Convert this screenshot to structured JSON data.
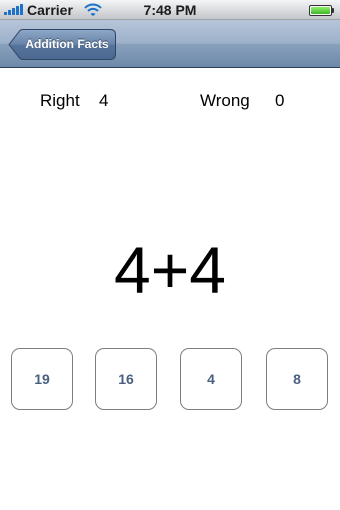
{
  "status_bar": {
    "carrier": "Carrier",
    "time": "7:48 PM",
    "signal_icon": "signal-bars-icon",
    "wifi_icon": "wifi-icon",
    "battery_icon": "battery-icon",
    "battery_level": 1.0,
    "accent_color": "#1a73c8"
  },
  "nav_bar": {
    "back_button_label": "Addition Facts",
    "tint_color": "#6d88aa"
  },
  "score": {
    "right_label": "Right",
    "right_value": "4",
    "wrong_label": "Wrong",
    "wrong_value": "0"
  },
  "problem": {
    "expression": "4+4"
  },
  "answers": [
    {
      "label": "19"
    },
    {
      "label": "16"
    },
    {
      "label": "4"
    },
    {
      "label": "8"
    }
  ],
  "colors": {
    "answer_text": "#4a6080"
  }
}
